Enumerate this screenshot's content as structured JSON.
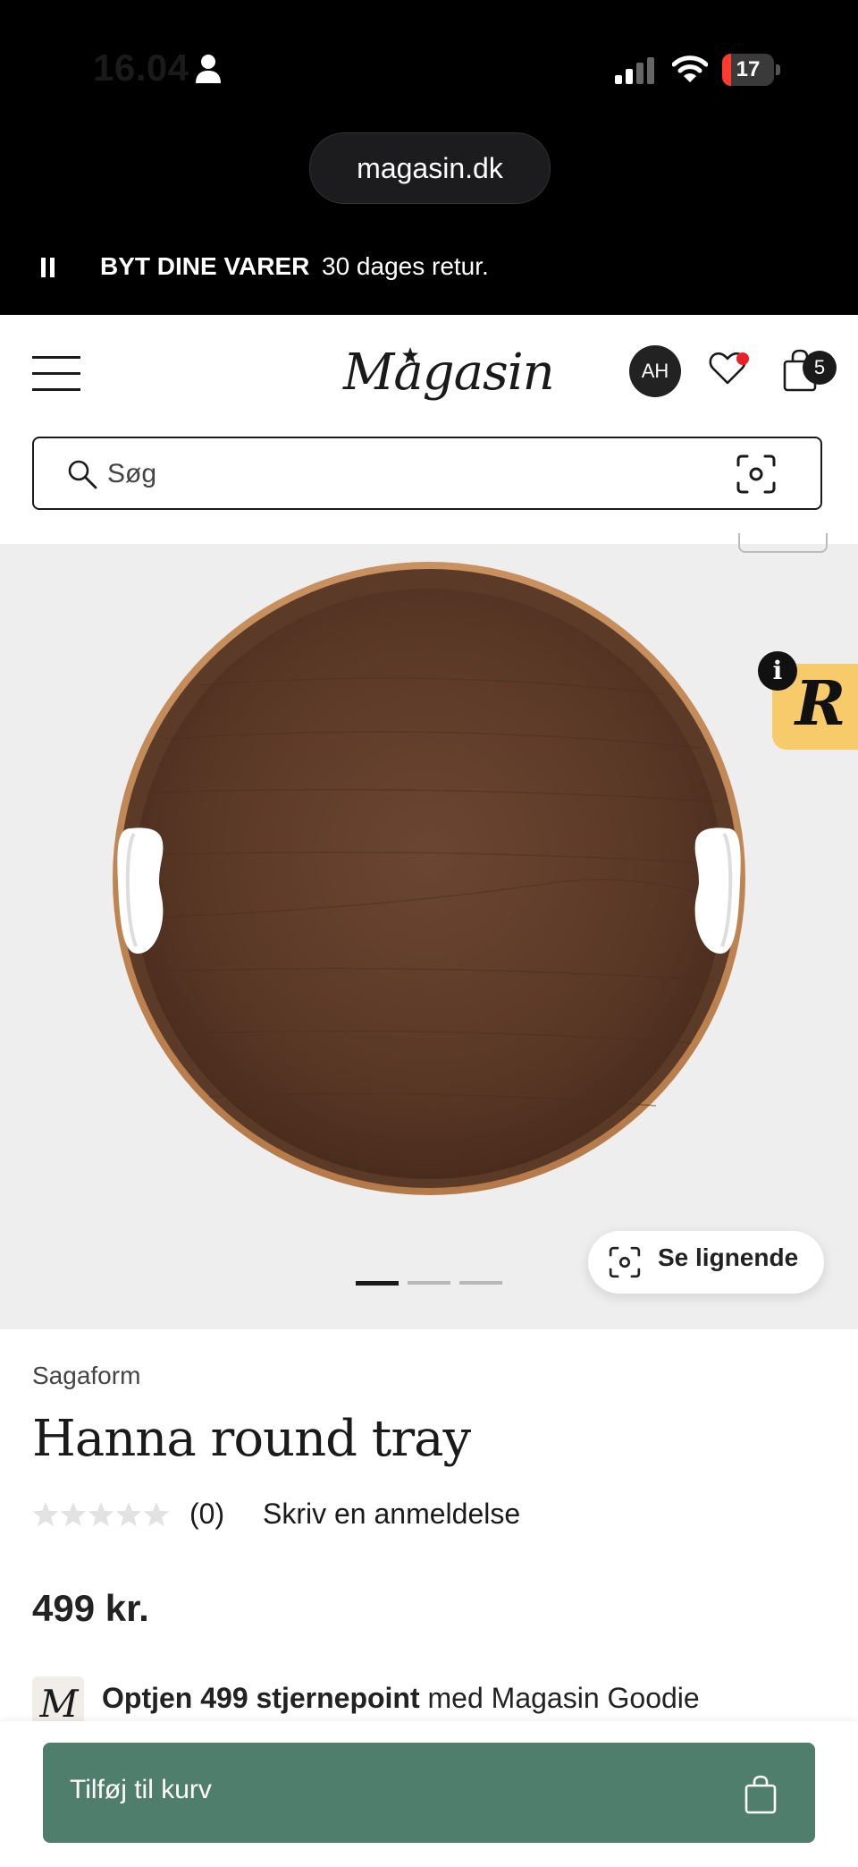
{
  "status_bar": {
    "time": "16.04",
    "battery": "17",
    "battery_level_percent": 17,
    "url": "magasin.dk"
  },
  "promo": {
    "title": "BYT DINE VARER",
    "text": "30 dages retur."
  },
  "header": {
    "logo": "Magasin",
    "avatar_initials": "AH",
    "cart_count": "5",
    "search_placeholder": "Søg"
  },
  "gallery": {
    "badge_letter": "R",
    "info_label": "i",
    "similar_label": "Se lignende",
    "slide_count": 3,
    "active_slide": 1
  },
  "product": {
    "brand": "Sagaform",
    "title": "Hanna round tray",
    "rating_stars": 0,
    "rating_count": "(0)",
    "review_link": "Skriv en anmeldelse",
    "price": "499 kr.",
    "goodie_logo": "M",
    "goodie_bold": "Optjen 499 stjernepoint",
    "goodie_rest": " med Magasin Goodie"
  },
  "cart_button": {
    "label": "Tilføj til kurv"
  },
  "colors": {
    "accent_green": "#4f7e6d",
    "badge_yellow": "#f7cb6a",
    "notification_red": "#e8202a",
    "battery_red": "#ff3b30"
  }
}
